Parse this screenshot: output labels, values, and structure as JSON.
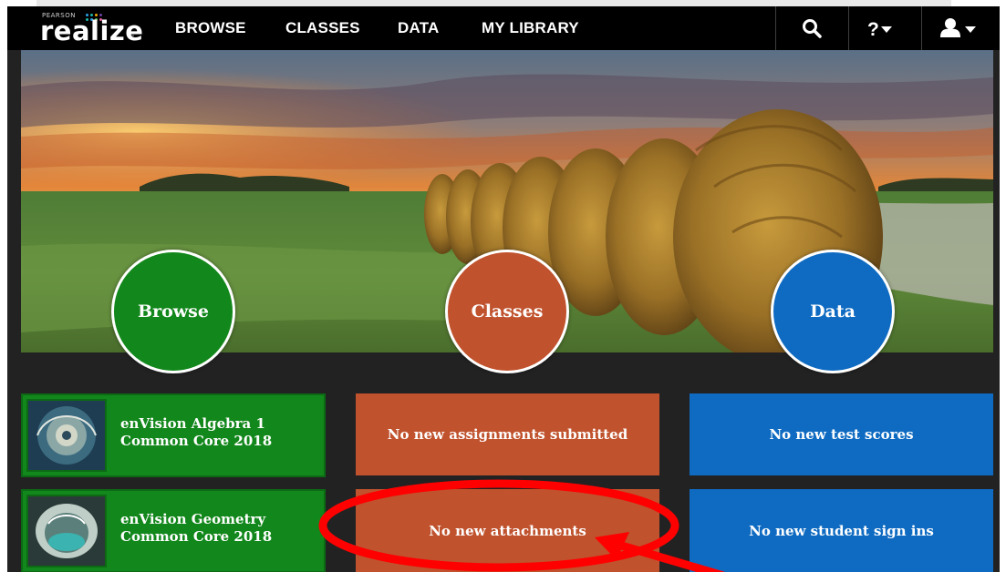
{
  "brand": {
    "small_text": "PEARSON",
    "name": "realize",
    "trademark": "™"
  },
  "nav": {
    "items": [
      "BROWSE",
      "CLASSES",
      "DATA",
      "MY LIBRARY"
    ],
    "icons": [
      "search-icon",
      "help-icon",
      "user-icon"
    ]
  },
  "hero": {
    "circles": {
      "browse": "Browse",
      "classes": "Classes",
      "data": "Data"
    }
  },
  "courses": [
    {
      "title_line1": "enVision Algebra 1",
      "title_line2": "Common Core 2018"
    },
    {
      "title_line1": "enVision Geometry",
      "title_line2": "Common Core 2018"
    }
  ],
  "classes_tiles": [
    "No new assignments submitted",
    "No new attachments"
  ],
  "data_tiles": [
    "No new test scores",
    "No new student sign ins"
  ],
  "colors": {
    "browse_green": "#12871b",
    "classes_orange": "#c0522d",
    "data_blue": "#0f6bc2",
    "annotation_red": "#ff0000"
  }
}
